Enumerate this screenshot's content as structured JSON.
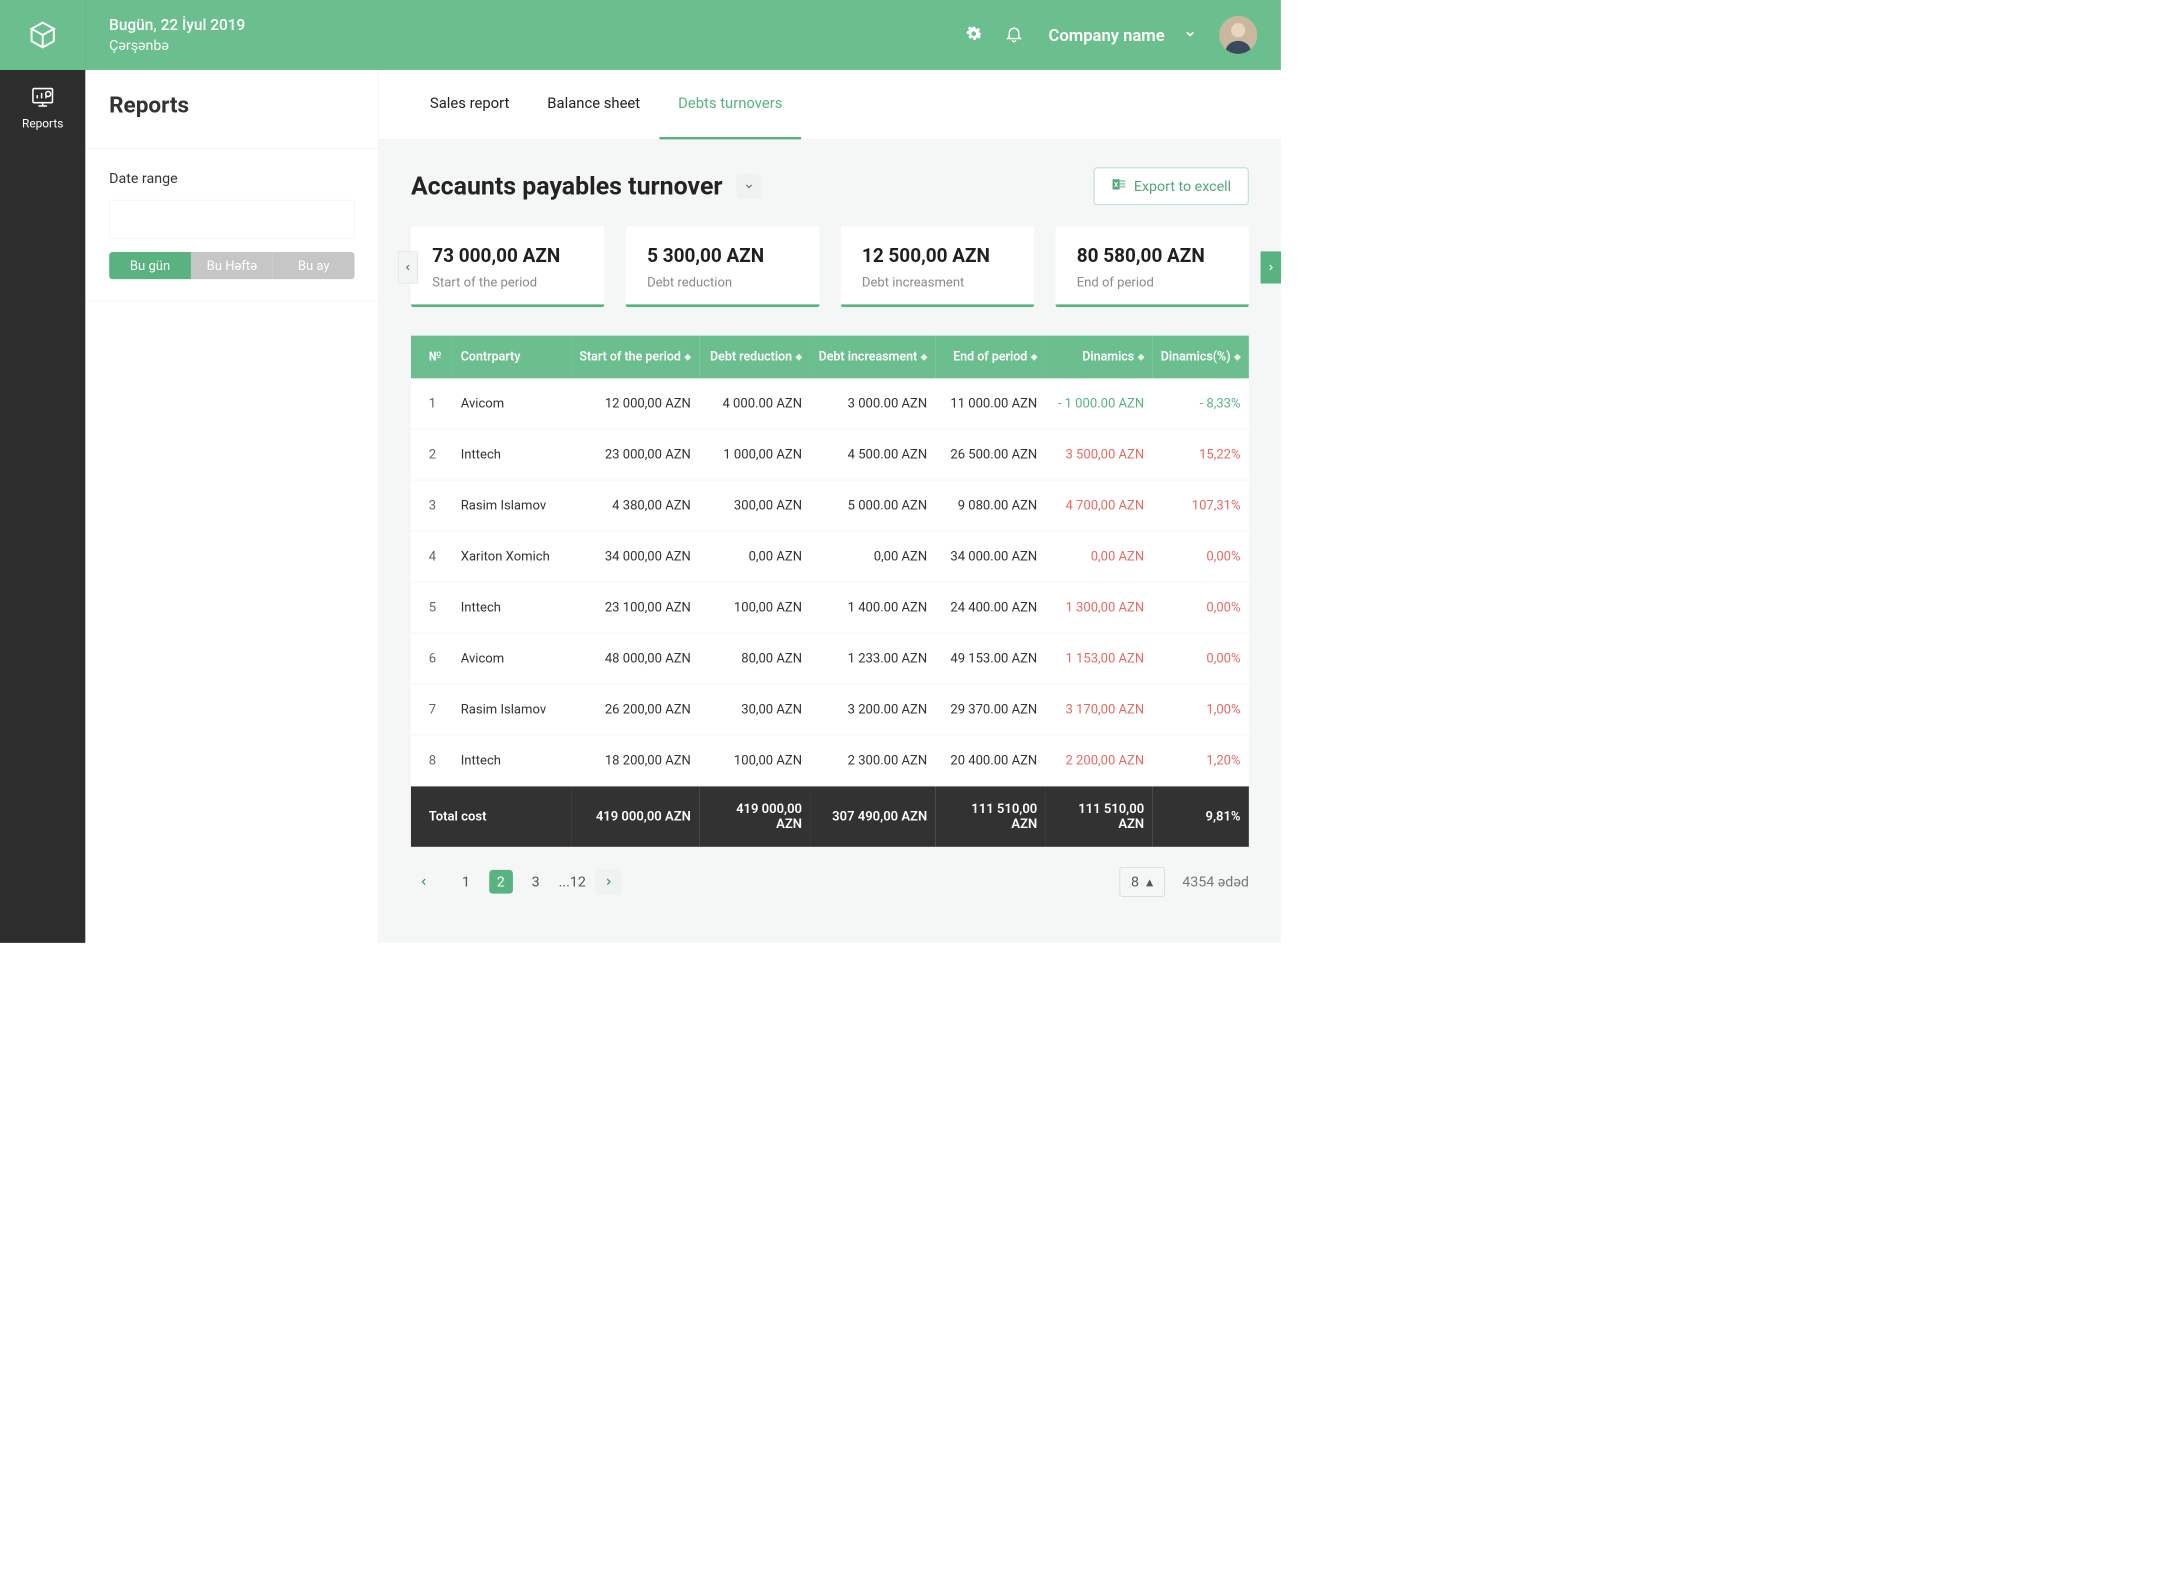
{
  "header": {
    "date": "Bugün, 22 İyul 2019",
    "day": "Çərşənbə",
    "company": "Company name"
  },
  "rail": {
    "reports": "Reports"
  },
  "side": {
    "title": "Reports",
    "date_range_label": "Date range",
    "seg_today": "Bu gün",
    "seg_week": "Bu Həftə",
    "seg_month": "Bu ay"
  },
  "tabs": {
    "sales": "Sales report",
    "balance": "Balance sheet",
    "debts": "Debts turnovers"
  },
  "page": {
    "title": "Accaunts payables turnover",
    "export": "Export to excell"
  },
  "kpis": [
    {
      "value": "73 000,00 AZN",
      "label": "Start of the period"
    },
    {
      "value": "5 300,00 AZN",
      "label": "Debt reduction"
    },
    {
      "value": "12 500,00 AZN",
      "label": "Debt increasment"
    },
    {
      "value": "80 580,00 AZN",
      "label": "End of period"
    }
  ],
  "columns": {
    "num": "№",
    "contrparty": "Contrparty",
    "start": "Start of the period",
    "reduction": "Debt reduction",
    "increase": "Debt increasment",
    "end": "End of period",
    "dinamics": "Dinamics",
    "dinamics_pct": "Dinamics(%)"
  },
  "rows": [
    {
      "n": "1",
      "cp": "Avicom",
      "start": "12 000,00 AZN",
      "red": "4 000.00 AZN",
      "inc": "3 000.00 AZN",
      "end": "11 000.00 AZN",
      "din": "- 1 000.00 AZN",
      "pct": "- 8,33%",
      "cls": "pos"
    },
    {
      "n": "2",
      "cp": "Inttech",
      "start": "23 000,00 AZN",
      "red": "1 000,00 AZN",
      "inc": "4 500.00 AZN",
      "end": "26 500.00 AZN",
      "din": "3 500,00 AZN",
      "pct": "15,22%",
      "cls": "neg"
    },
    {
      "n": "3",
      "cp": "Rasim Islamov",
      "start": "4 380,00 AZN",
      "red": "300,00 AZN",
      "inc": "5 000.00 AZN",
      "end": "9 080.00 AZN",
      "din": "4 700,00 AZN",
      "pct": "107,31%",
      "cls": "neg"
    },
    {
      "n": "4",
      "cp": "Xariton Xomich",
      "start": "34 000,00 AZN",
      "red": "0,00 AZN",
      "inc": "0,00 AZN",
      "end": "34 000.00 AZN",
      "din": "0,00 AZN",
      "pct": "0,00%",
      "cls": "neg"
    },
    {
      "n": "5",
      "cp": "Inttech",
      "start": "23 100,00 AZN",
      "red": "100,00 AZN",
      "inc": "1 400.00 AZN",
      "end": "24 400.00 AZN",
      "din": "1 300,00 AZN",
      "pct": "0,00%",
      "cls": "neg"
    },
    {
      "n": "6",
      "cp": "Avicom",
      "start": "48 000,00 AZN",
      "red": "80,00 AZN",
      "inc": "1 233.00 AZN",
      "end": "49 153.00 AZN",
      "din": "1 153,00 AZN",
      "pct": "0,00%",
      "cls": "neg"
    },
    {
      "n": "7",
      "cp": "Rasim Islamov",
      "start": "26 200,00 AZN",
      "red": "30,00 AZN",
      "inc": "3 200.00 AZN",
      "end": "29 370.00 AZN",
      "din": "3 170,00 AZN",
      "pct": "1,00%",
      "cls": "neg"
    },
    {
      "n": "8",
      "cp": "Inttech",
      "start": "18 200,00 AZN",
      "red": "100,00 AZN",
      "inc": "2 300.00 AZN",
      "end": "20 400.00 AZN",
      "din": "2 200,00 AZN",
      "pct": "1,20%",
      "cls": "neg"
    }
  ],
  "totals": {
    "label": "Total cost",
    "start": "419 000,00 AZN",
    "red": "419 000,00 AZN",
    "inc": "307 490,00 AZN",
    "end": "111 510,00 AZN",
    "din": "111 510,00 AZN",
    "pct": "9,81%"
  },
  "pagination": {
    "p1": "1",
    "p2": "2",
    "p3": "3",
    "p12": "...12",
    "per_page": "8",
    "total": "4354 ədəd"
  }
}
